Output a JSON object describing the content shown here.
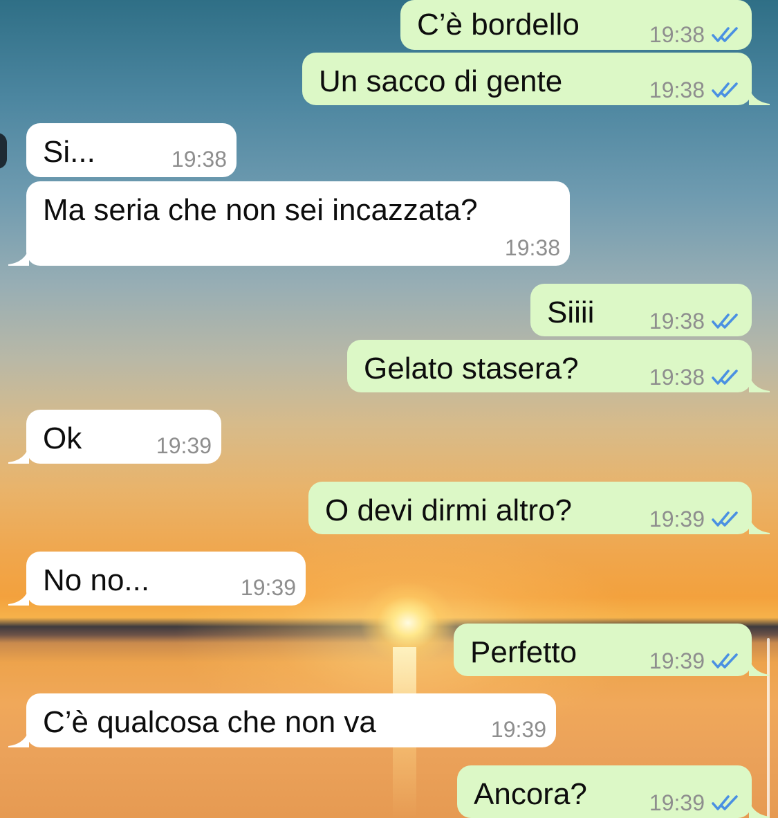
{
  "chat": {
    "messages": [
      {
        "dir": "out",
        "text": "C’è bordello",
        "time": "19:38",
        "read": true
      },
      {
        "dir": "out",
        "text": "Un sacco di gente",
        "time": "19:38",
        "read": true
      },
      {
        "dir": "in",
        "text": "Si...",
        "time": "19:38"
      },
      {
        "dir": "in",
        "text": "Ma seria che non sei incazzata?",
        "time": "19:38"
      },
      {
        "dir": "out",
        "text": "Siiii",
        "time": "19:38",
        "read": true
      },
      {
        "dir": "out",
        "text": "Gelato stasera?",
        "time": "19:38",
        "read": true
      },
      {
        "dir": "in",
        "text": "Ok",
        "time": "19:39"
      },
      {
        "dir": "out",
        "text": "O devi dirmi altro?",
        "time": "19:39",
        "read": true
      },
      {
        "dir": "in",
        "text": "No no...",
        "time": "19:39"
      },
      {
        "dir": "out",
        "text": "Perfetto",
        "time": "19:39",
        "read": true
      },
      {
        "dir": "in",
        "text": "C’è qualcosa che non va",
        "time": "19:39"
      },
      {
        "dir": "out",
        "text": "Ancora?",
        "time": "19:39",
        "read": true
      }
    ]
  },
  "colors": {
    "outgoing_bubble": "#dcf8c6",
    "incoming_bubble": "#ffffff",
    "read_ticks": "#4a90e2",
    "timestamp": "#8e8e8e"
  },
  "icons": {
    "read_receipt": "double-check-icon"
  }
}
